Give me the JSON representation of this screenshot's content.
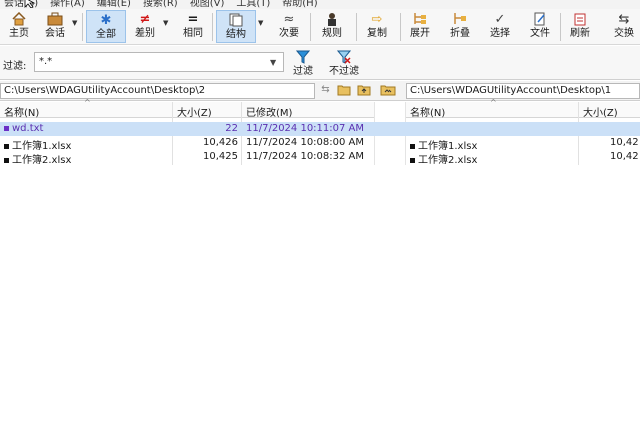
{
  "menu": {
    "items": [
      "会话(S)",
      "操作(A)",
      "编辑(E)",
      "搜索(R)",
      "视图(V)",
      "工具(T)",
      "帮助(H)"
    ]
  },
  "toolbar": {
    "home": "主页",
    "session": "会话",
    "all": "全部",
    "diffs": "差别",
    "same": "相同",
    "structure": "结构",
    "minor": "次要",
    "rules": "规则",
    "copy": "复制",
    "expand": "展开",
    "collapse": "折叠",
    "select": "选择",
    "files": "文件",
    "refresh": "刷新",
    "swap": "交换"
  },
  "filter": {
    "label": "过滤:",
    "value": "*.*",
    "filter_btn": "过滤",
    "nofilter_btn": "不过滤"
  },
  "left": {
    "path": "C:\\Users\\WDAGUtilityAccount\\Desktop\\2",
    "headers": {
      "name": "名称(N)",
      "size": "大小(Z)",
      "modified": "已修改(M)"
    },
    "rows": [
      {
        "name": "wd.txt",
        "size": "22",
        "modified": "11/7/2024 10:11:07 AM"
      },
      {
        "name": "工作簿1.xlsx",
        "size": "10,426",
        "modified": "11/7/2024 10:08:00 AM"
      },
      {
        "name": "工作簿2.xlsx",
        "size": "10,425",
        "modified": "11/7/2024 10:08:32 AM"
      }
    ]
  },
  "right": {
    "path": "C:\\Users\\WDAGUtilityAccount\\Desktop\\1",
    "headers": {
      "name": "名称(N)",
      "size": "大小(Z)"
    },
    "rows": [
      {
        "name": "",
        "size": ""
      },
      {
        "name": "工作簿1.xlsx",
        "size": "10,42"
      },
      {
        "name": "工作簿2.xlsx",
        "size": "10,42"
      }
    ]
  },
  "colors": {
    "selection": "#cbe0f7",
    "selected_text": "#5a2fb0",
    "diff_red": "#d01818",
    "accent_blue": "#2a6fc9"
  }
}
